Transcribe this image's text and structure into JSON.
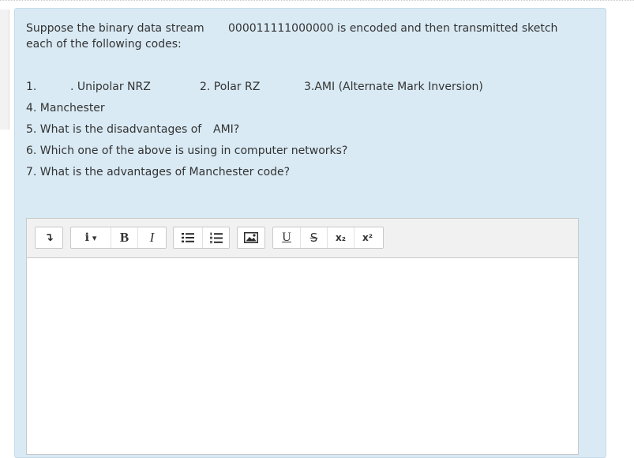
{
  "question": {
    "intro_line1_a": "Suppose the binary data stream",
    "intro_line1_b": "000011111000000 is encoded and then transmitted sketch",
    "intro_line2": "each of the following codes:",
    "item1_num": "1.",
    "item1_text": ". Unipolar NRZ",
    "item2_text": "2. Polar RZ",
    "item3_text": "3.AMI (Alternate Mark Inversion)",
    "item4_text": "4. Manchester",
    "item5_a": "5. What is the disadvantages of",
    "item5_b": "AMI?",
    "item6_text": "6. Which one of the above is using in computer networks?",
    "item7_text": "7. What is the advantages of Manchester code?"
  },
  "toolbar": {
    "insert_arrow": "↴",
    "info_label": "i",
    "info_caret": "▾",
    "bold_label": "B",
    "italic_label": "I",
    "underline_label": "U",
    "strike_label": "S",
    "subscript_label": "x₂",
    "superscript_label": "x²"
  },
  "icons": {
    "insert": "arrow-down-icon",
    "bullet_list": "bullet-list-icon",
    "numbered_list": "numbered-list-icon",
    "image": "image-icon"
  },
  "colors": {
    "panel_bg": "#d9eaf4",
    "toolbar_bg": "#f1f1f1",
    "text": "#333333",
    "icon_dark": "#2b2b2b"
  }
}
